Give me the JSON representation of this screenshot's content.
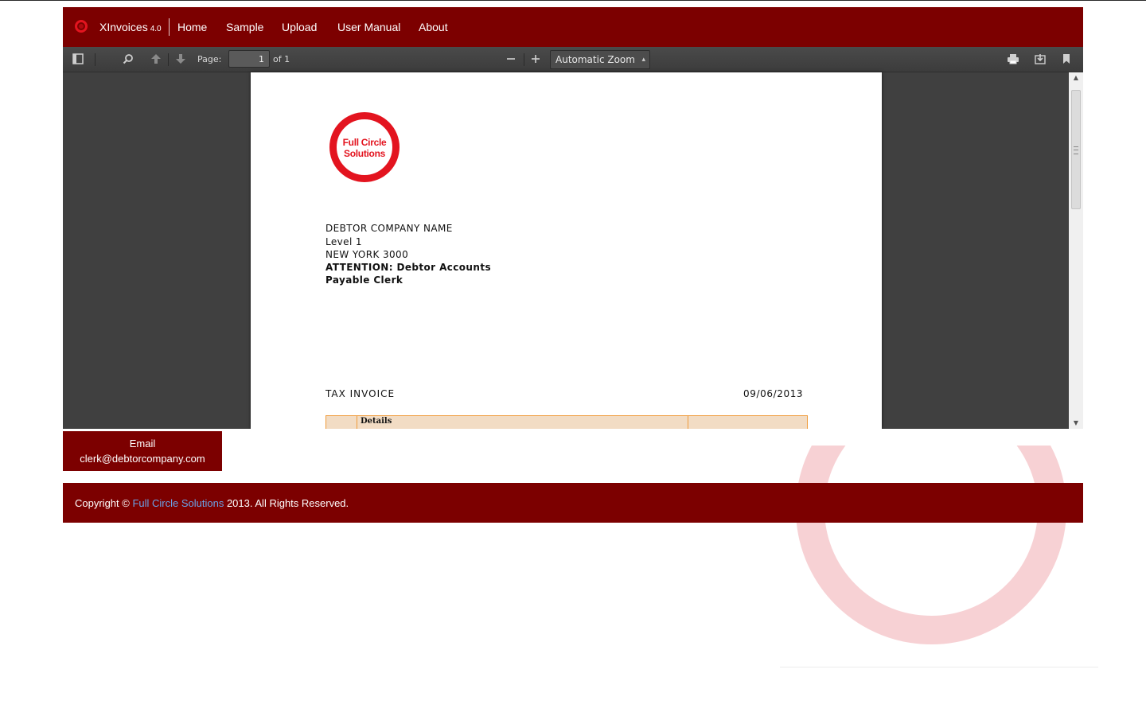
{
  "navbar": {
    "brand": "XInvoices",
    "version": "4.0",
    "links": [
      "Home",
      "Sample",
      "Upload",
      "User Manual",
      "About"
    ]
  },
  "viewer": {
    "toolbar": {
      "sidebar_toggle_icon": "sidebar-toggle-icon",
      "find_icon": "search-icon",
      "prev_icon": "arrow-up-icon",
      "next_icon": "arrow-down-icon",
      "page_label": "Page:",
      "page_value": "1",
      "page_of": "of 1",
      "zoom_out_icon": "minus-icon",
      "zoom_in_icon": "plus-icon",
      "zoom_value": "Automatic Zoom",
      "print_icon": "print-icon",
      "download_icon": "download-icon",
      "bookmark_icon": "bookmark-icon"
    },
    "document": {
      "logo_text_line1": "Full Circle",
      "logo_text_line2": "Solutions",
      "address": [
        "DEBTOR COMPANY NAME",
        "Level 1",
        "NEW YORK 3000"
      ],
      "attention_line1": "ATTENTION: Debtor Accounts",
      "attention_line2": "Payable Clerk",
      "title": "TAX INVOICE",
      "date": "09/06/2013",
      "table_header": "Details"
    }
  },
  "email_box": {
    "label": "Email",
    "address": "clerk@debtorcompany.com"
  },
  "footer": {
    "prefix": "Copyright ©",
    "company_link": "Full Circle Solutions",
    "suffix": "2013. All Rights Reserved."
  },
  "colors": {
    "brand_dark_red": "#7c0000",
    "logo_red": "#e3141f",
    "viewer_bg": "#404040",
    "table_fill": "#f2dcc4",
    "table_border": "#f09c3c",
    "footer_link": "#6aa2e6"
  }
}
